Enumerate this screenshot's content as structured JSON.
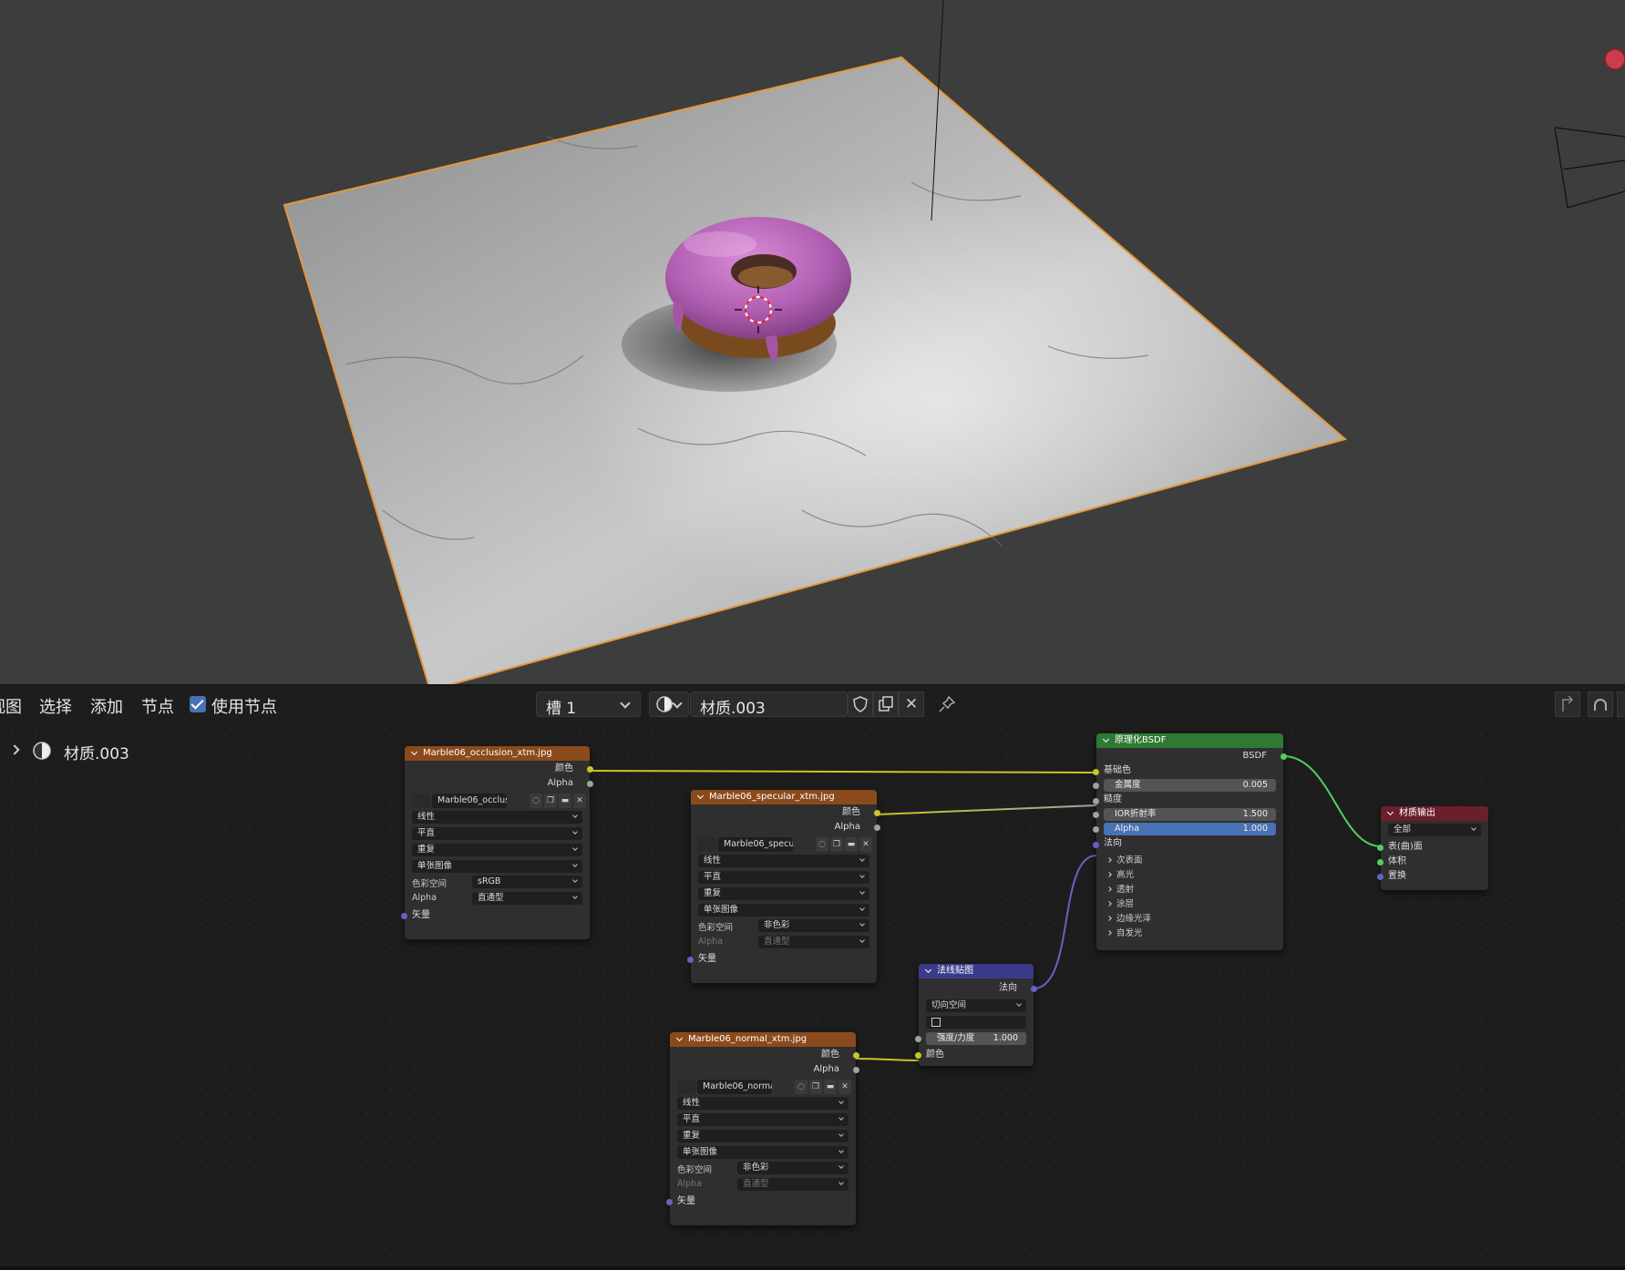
{
  "header": {
    "menu": [
      "视图",
      "选择",
      "添加",
      "节点"
    ],
    "use_nodes_label": "使用节点",
    "slot": "槽 1",
    "material_name": "材质.003"
  },
  "sidebar": {
    "material_name": "材质.003"
  },
  "colors": {
    "selection_outline": "#e8963a",
    "donut_icing": "#b15fb2",
    "image_node_header": "#8b4a1c",
    "bsdf_node_header": "#2f7a32",
    "normal_map_header": "#3b3b8c",
    "output_node_header": "#6b1e2b",
    "socket_color": "#c7c729",
    "socket_vector": "#6363c7",
    "socket_shader": "#4fcf63"
  },
  "nodes": {
    "occlusion": {
      "title": "Marble06_occlusion_xtm.jpg",
      "out_color": "颜色",
      "out_alpha": "Alpha",
      "image_name": "Marble06_occlusi...",
      "interp": "线性",
      "projection": "平直",
      "extension": "重复",
      "source": "单张图像",
      "colorspace_label": "色彩空间",
      "colorspace": "sRGB",
      "alpha_label": "Alpha",
      "alpha": "直通型",
      "vector": "矢量"
    },
    "specular": {
      "title": "Marble06_specular_xtm.jpg",
      "out_color": "颜色",
      "out_alpha": "Alpha",
      "image_name": "Marble06_specul...",
      "interp": "线性",
      "projection": "平直",
      "extension": "重复",
      "source": "单张图像",
      "colorspace_label": "色彩空间",
      "colorspace": "非色彩",
      "alpha_label": "Alpha",
      "alpha": "直通型",
      "vector": "矢量"
    },
    "normal": {
      "title": "Marble06_normal_xtm.jpg",
      "out_color": "颜色",
      "out_alpha": "Alpha",
      "image_name": "Marble06_normal...",
      "interp": "线性",
      "projection": "平直",
      "extension": "重复",
      "source": "单张图像",
      "colorspace_label": "色彩空间",
      "colorspace": "非色彩",
      "alpha_label": "Alpha",
      "alpha": "直通型",
      "vector": "矢量"
    },
    "normal_map": {
      "title": "法线贴图",
      "out_normal": "法向",
      "space": "切向空间",
      "strength_label": "强度/力度",
      "strength": "1.000",
      "in_color": "颜色"
    },
    "bsdf": {
      "title": "原理化BSDF",
      "out": "BSDF",
      "base_color": "基础色",
      "metallic_label": "金属度",
      "metallic": "0.005",
      "roughness": "糙度",
      "ior_label": "IOR折射率",
      "ior": "1.500",
      "alpha_label": "Alpha",
      "alpha": "1.000",
      "normal": "法向",
      "sections": [
        "次表面",
        "高光",
        "透射",
        "涂层",
        "边缘光泽",
        "自发光"
      ]
    },
    "output": {
      "title": "材质输出",
      "target": "全部",
      "surface": "表(曲)面",
      "volume": "体积",
      "displacement": "置换"
    }
  }
}
